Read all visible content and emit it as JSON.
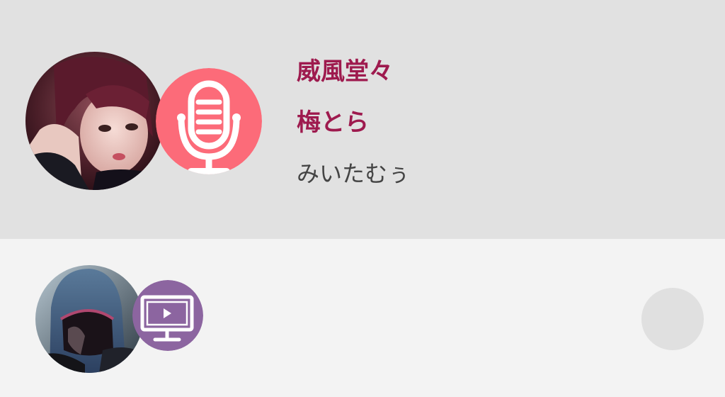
{
  "items": [
    {
      "type": "audio",
      "badge_icon": "microphone-icon",
      "badge_color": "#fc6b79",
      "lines": [
        "威風堂々",
        "梅とら",
        "みいたむぅ"
      ],
      "title_color": "#9e1a4e",
      "subtitle_color": "#444444"
    },
    {
      "type": "video",
      "badge_icon": "monitor-play-icon",
      "badge_color": "#8c65a0",
      "lines": []
    }
  ],
  "colors": {
    "top_background": "#e1e1e1",
    "bottom_background": "#f3f3f3",
    "action_button": "#e0e0e0"
  }
}
